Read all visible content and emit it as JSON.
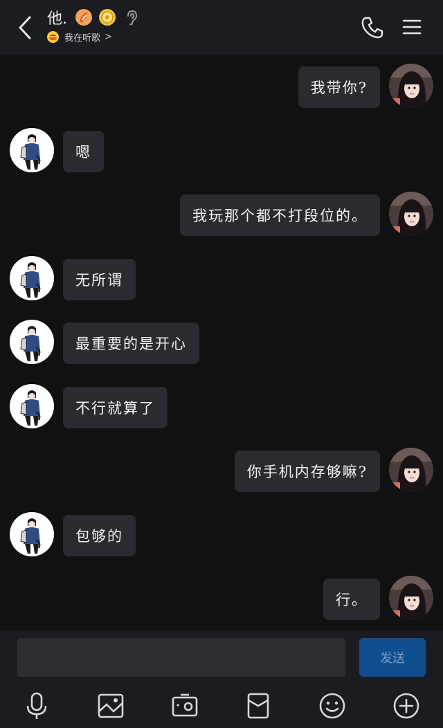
{
  "header": {
    "title": "他.",
    "subtitle": "我在听歌",
    "subtitle_chevron": ">"
  },
  "messages": [
    {
      "side": "me",
      "text": "我带你?"
    },
    {
      "side": "other",
      "text": "嗯"
    },
    {
      "side": "me",
      "text": "我玩那个都不打段位的。"
    },
    {
      "side": "other",
      "text": "无所谓"
    },
    {
      "side": "other",
      "text": "最重要的是开心"
    },
    {
      "side": "other",
      "text": "不行就算了"
    },
    {
      "side": "me",
      "text": "你手机内存够嘛?"
    },
    {
      "side": "other",
      "text": "包够的"
    },
    {
      "side": "me",
      "text": "行。"
    }
  ],
  "composer": {
    "input_value": "",
    "send_label": "发送"
  },
  "toolbar": {
    "icons": [
      "microphone-icon",
      "image-icon",
      "camera-icon",
      "red-packet-icon",
      "emoji-icon",
      "plus-icon"
    ]
  },
  "colors": {
    "background": "#111111",
    "bar": "#1a1c21",
    "bubble": "#2a2b30",
    "send_button": "#0f4e8f"
  }
}
